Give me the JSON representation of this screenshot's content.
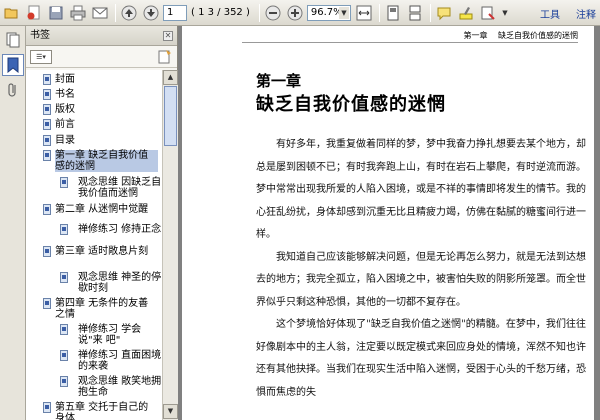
{
  "toolbar": {
    "page_current": "1",
    "page_count": "( 1 3 / 352 )",
    "zoom": "96.7%",
    "tools_label": "工具",
    "comment_label": "注释"
  },
  "bookmarks": {
    "title": "书签",
    "items": [
      {
        "label": "封面"
      },
      {
        "label": "书名"
      },
      {
        "label": "版权"
      },
      {
        "label": "前言"
      },
      {
        "label": "目录"
      },
      {
        "label": "第一章 缺乏自我价值 感的迷惘",
        "lines": [
          "第一章 缺乏自我价值",
          "感的迷惘"
        ]
      },
      {
        "label": "观念思维 因缺乏自 我价值而迷惘",
        "lines": [
          "观念思维 因缺乏自",
          "我价值而迷惘"
        ]
      },
      {
        "label": "第二章 从迷惘中觉醒",
        "lines": [
          "第二章 从迷惘中觉醒"
        ]
      },
      {
        "label": "禅修练习 修持正念",
        "lines": [
          "禅修练习 修持正念"
        ]
      },
      {
        "label": "第三章 适时敞息片刻",
        "lines": [
          "第三章 适时敞息片刻"
        ]
      },
      {
        "label": "观念思维 神圣的停 歇时刻",
        "lines": [
          "观念思维 神圣的停",
          "歇时刻"
        ]
      },
      {
        "label": "第四章 无条件的友善 之情",
        "lines": [
          "第四章 无条件的友善",
          "之情"
        ]
      },
      {
        "label": "禅修练习 学会说\"来 吧\"",
        "lines": [
          "禅修练习 学会说\"来",
          "吧\""
        ]
      },
      {
        "label": "禅修练习 直面困境 的来袭",
        "lines": [
          "禅修练习 直面困境",
          "的来袭"
        ]
      },
      {
        "label": "观念思维 敞笑地拥 抱生命",
        "lines": [
          "观念思维 敞笑地拥",
          "抱生命"
        ]
      },
      {
        "label": "第五章 交托于自己的 身体",
        "lines": [
          "第五章 交托于自己的",
          "身体"
        ]
      }
    ]
  },
  "document": {
    "running_head_chapter": "第一章",
    "running_head_title": "缺乏自我价值感的迷惘",
    "chapter_number": "第一章",
    "chapter_title": "缺乏自我价值感的迷惘",
    "paragraphs": [
      "有好多年，我重复做着同样的梦，梦中我奋力挣扎想要去某个地方，却总是屡到困顿不已；有时我奔跑上山，有时在岩石上攀爬，有时逆流而游。梦中常常出现我所爱的人陷入困境，或是不祥的事情即将发生的情节。我的心狂乱纷扰，身体却感到沉重无比且精疲力竭，仿佛在黏腻的糖蜜间行进一样。",
      "我知道自己应该能够解决问题，但是无论再怎么努力，就是无法到达想去的地方；我完全孤立，陷入困境之中，被害怕失败的阴影所笼罩。而全世界似乎只剩这种恐惧，其他的一切都不复存在。",
      "这个梦境恰好体现了\"缺乏自我价值之迷惘\"的精髓。在梦中，我们往往好像剧本中的主人翁，注定要以既定模式来回应身处的情境，浑然不知也许还有其他抉择。当我们在现实生活中陷入迷惘，受困于心头的千愁万绪，恐惧而焦虑的失"
    ]
  },
  "colors": {
    "accent": "#1a3f9a",
    "toolbar_bg": "#dcd9cf",
    "selection": "#b9c9e4"
  },
  "icons": [
    "panel-icon",
    "bookmark-ribbon-icon",
    "attachment-icon",
    "save-icon",
    "print-icon",
    "email-icon",
    "prev-page-icon",
    "next-page-icon",
    "zoom-out-icon",
    "zoom-in-icon",
    "page-view-icon",
    "comment-icon",
    "highlight-icon",
    "expand-icon"
  ]
}
